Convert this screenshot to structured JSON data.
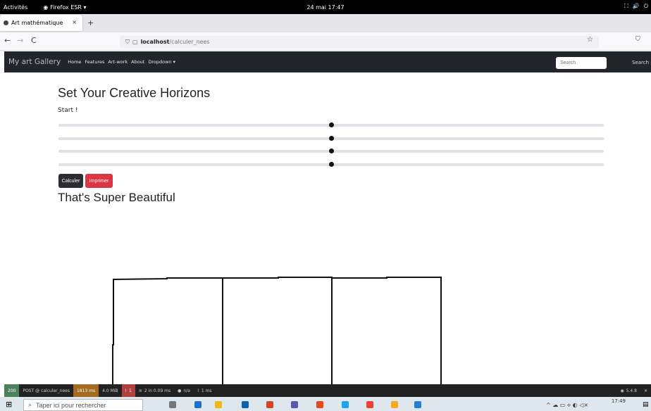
{
  "topbar": {
    "activities": "Activités",
    "app": "Firefox ESR ▾",
    "clock": "24 mai 17:47",
    "tray": [
      "⛶",
      "🔊",
      "⏻"
    ]
  },
  "tab": {
    "title": "Art mathématique",
    "close": "×",
    "new": "+"
  },
  "nav": {
    "back": "←",
    "forward": "→",
    "reload": "C",
    "url_host": "localhost",
    "url_path": "/calculer_nees",
    "star": "☆",
    "shield": "⛉"
  },
  "site": {
    "brand": "My art Gallery",
    "links": [
      "Home",
      "Features",
      "Art-work",
      "About",
      "Dropdown ▾"
    ],
    "search_placeholder": "Search",
    "search_button": "Search"
  },
  "page": {
    "heading": "Set Your Creative Horizons",
    "start": "Start !",
    "sliders": [
      0.5,
      0.5,
      0.5,
      0.5
    ],
    "calc_button": "Calculer",
    "print_button": "Imprimer",
    "subheading": "That's Super Beautiful"
  },
  "debug": {
    "status": "200",
    "route": "POST @ calculer_nees",
    "time": "1813 ms",
    "memory": "4.0 MiB",
    "errors": "1",
    "cache": "2 in 0.09 ms",
    "user": "n/a",
    "twig": "1 ms",
    "version": "5.4.8"
  },
  "taskbar": {
    "search_placeholder": "Taper ici pour rechercher",
    "time": "17:49"
  }
}
